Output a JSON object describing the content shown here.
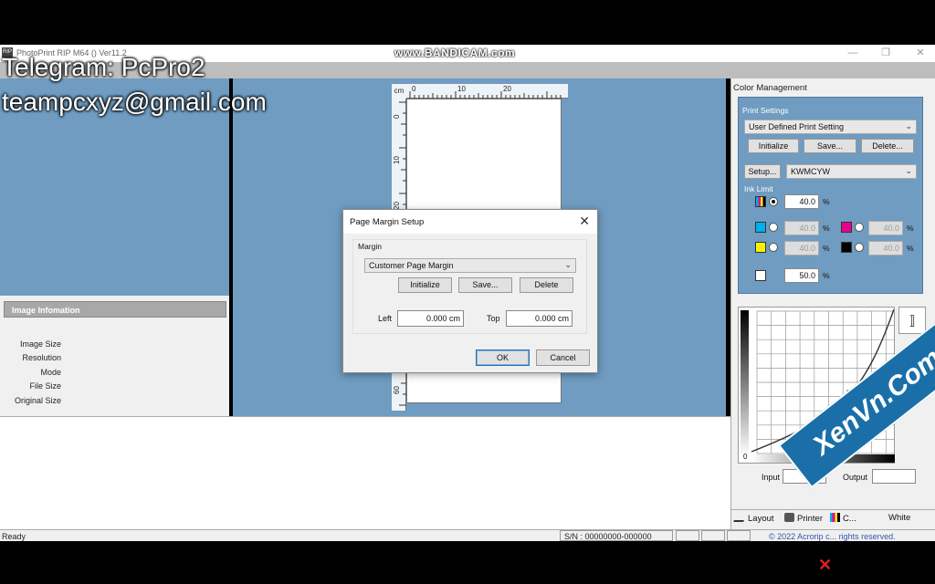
{
  "window": {
    "title": "PhotoPrint RIP M64 () Ver11.2",
    "recorder_watermark": "www.BANDICAM.com",
    "app_icon_label": "RIP"
  },
  "overlay": {
    "telegram": "Telegram: PcPro2",
    "email": "teampcxyz@gmail.com"
  },
  "image_info": {
    "heading": "Image Infomation",
    "labels": [
      "Image Size",
      "Resolution",
      "Mode",
      "File Size",
      "Original Size"
    ]
  },
  "ruler": {
    "unit": "cm",
    "top_marks": [
      "0",
      "10",
      "20"
    ],
    "left_marks": [
      "0",
      "10",
      "20",
      "60"
    ]
  },
  "status": {
    "ready": "Ready",
    "serial": "S/N : 00000000-000000",
    "copyright": "© 2022 Acrorip c... rights reserved."
  },
  "color_management": {
    "title": "Color Management",
    "print_settings_label": "Print Settings",
    "print_setting_selected": "User Defined Print Setting",
    "buttons": {
      "initialize": "Initialize",
      "save": "Save...",
      "delete": "Delete..."
    },
    "setup_label": "Setup...",
    "channel_selected": "KWMCYW",
    "ink_limit_label": "Ink Limit",
    "ink_limits": {
      "all": "40.0",
      "cyan": "40.0",
      "magenta": "40.0",
      "yellow": "40.0",
      "black": "40.0",
      "white": "50.0"
    },
    "percent": "%",
    "input_label": "Input",
    "input_value": "0",
    "output_label": "Output",
    "curve_zero": "0"
  },
  "tabs": [
    "Layout",
    "Printer",
    "C...",
    "White"
  ],
  "dialog": {
    "title": "Page Margin Setup",
    "group_label": "Margin",
    "margin_selected": "Customer Page Margin",
    "buttons": {
      "initialize": "Initialize",
      "save": "Save...",
      "delete": "Delete",
      "ok": "OK",
      "cancel": "Cancel"
    },
    "left_label": "Left",
    "left_value": "0.000 cm",
    "top_label": "Top",
    "top_value": "0.000 cm"
  },
  "site_watermark": "XenVn.Com",
  "colors": {
    "workspace_blue": "#6f9cc0",
    "panel_gray": "#f0f0f0",
    "cyan": "#00aeef",
    "magenta": "#ec008c",
    "yellow": "#fff200",
    "black": "#000000",
    "white": "#ffffff"
  }
}
